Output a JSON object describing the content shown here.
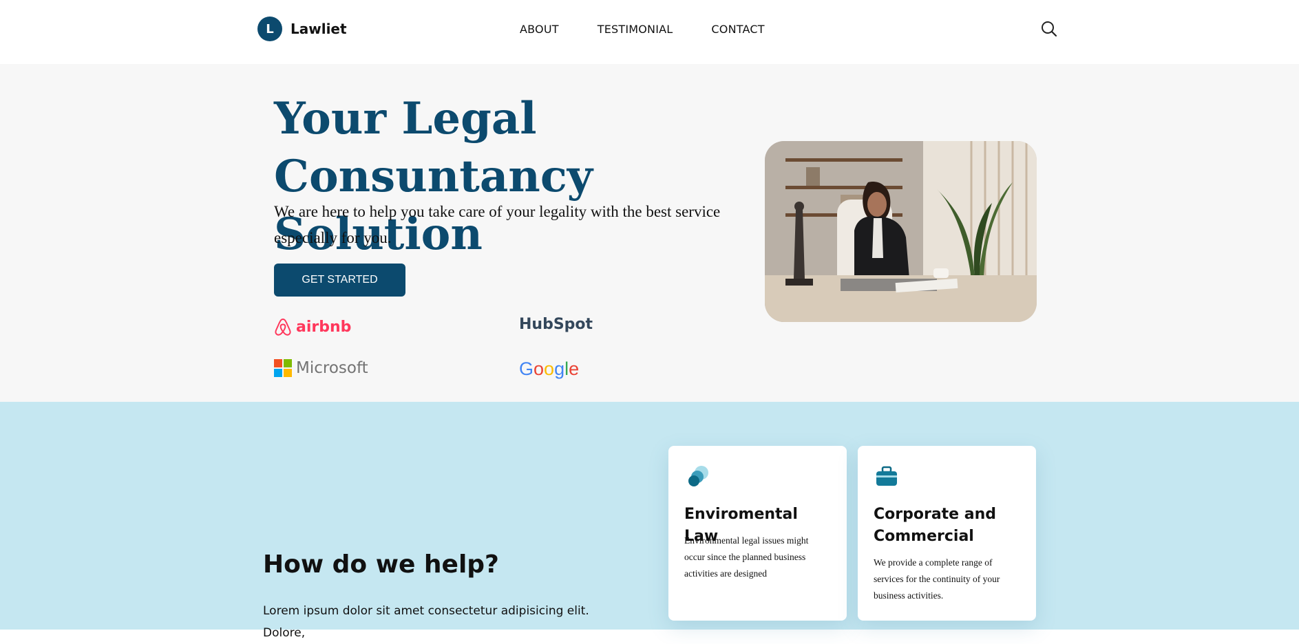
{
  "nav": {
    "brand_letter": "L",
    "brand_name": "Lawliet",
    "items": [
      {
        "label": "ABOUT"
      },
      {
        "label": "TESTIMONIAL"
      },
      {
        "label": "CONTACT"
      }
    ],
    "search_icon": "search-icon"
  },
  "hero": {
    "title": "Your Legal Consuntancy Solution",
    "text": "We are here to help you take care of your legality with the best service especially for you.",
    "cta_label": "GET STARTED",
    "image_subject": "office-photo",
    "logos": {
      "airbnb": "airbnb",
      "hubspot": "HubSpot",
      "microsoft": "Microsoft",
      "google": "Google"
    }
  },
  "help": {
    "title": "How do we help?",
    "text": "Lorem ipsum dolor sit amet consectetur adipisicing elit. Dolore,"
  },
  "cards": [
    {
      "icon": "circles-icon",
      "title": "Enviromental Law",
      "text": "Environmental legal issues might occur since the planned business activities are designed"
    },
    {
      "icon": "briefcase-icon",
      "title": "Corporate and Commercial",
      "text": "We provide a complete range of services for the continuity of your business activities."
    }
  ],
  "colors": {
    "brand": "#0c4a6e",
    "hero_bg": "#f7f7f7",
    "help_bg": "#c5e7f1",
    "airbnb": "#ff385c",
    "hubspot_accent": "#ff7a59"
  }
}
